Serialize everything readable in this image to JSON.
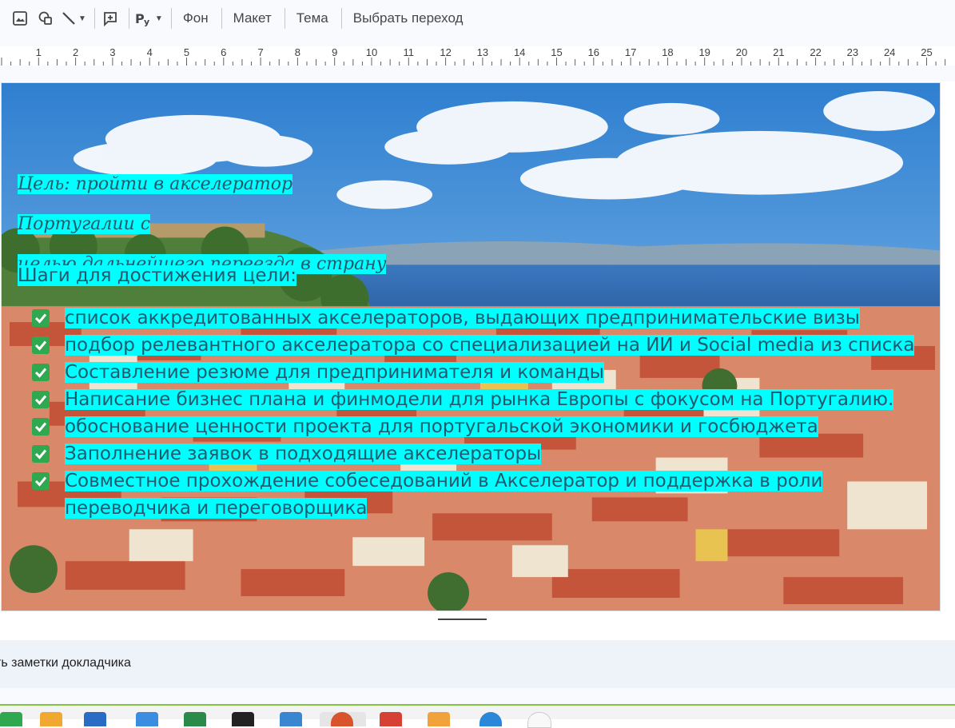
{
  "toolbar": {
    "items": [
      {
        "icon": "image-icon"
      },
      {
        "icon": "shapes-icon"
      },
      {
        "icon": "line-icon"
      },
      {
        "icon": "add-comment-icon"
      },
      {
        "icon": "input-tools-icon"
      }
    ],
    "background_label": "Фон",
    "layout_label": "Макет",
    "theme_label": "Тема",
    "transition_label": "Выбрать переход"
  },
  "ruler": {
    "numbers": [
      "1",
      "2",
      "3",
      "4",
      "5",
      "6",
      "7",
      "8",
      "9",
      "10",
      "11",
      "12",
      "13",
      "14",
      "15",
      "16",
      "17",
      "18",
      "19",
      "20",
      "21",
      "22",
      "23",
      "24",
      "25"
    ]
  },
  "slide": {
    "goal_line1": "Цель: пройти в акселератор Португалии с",
    "goal_line2": "целью дальнейшего переезда в страну",
    "steps_title": "Шаги для достижения цели:",
    "steps": [
      "список аккредитованных акселераторов, выдающих предпринимательские визы",
      "подбор релевантного акселератора со специализацией на ИИ и Social media из списка",
      "Составление резюме для предпринимателя и команды",
      "Написание бизнес плана и финмодели для рынка Европы с фокусом на Португалию.",
      "обоснование ценности проекта для португальской экономики и госбюджета",
      "Заполнение заявок в подходящие акселераторы",
      "Совместное прохождение собеседований в Акселератор и поддержка в роли переводчика и переговорщика"
    ],
    "highlight_color": "#00ffff",
    "text_color": "#215a6e",
    "check_color": "#2fa84f"
  },
  "notes": {
    "placeholder": "ть заметки докладчика"
  },
  "taskbar": {
    "accent_color": "#82c341"
  }
}
